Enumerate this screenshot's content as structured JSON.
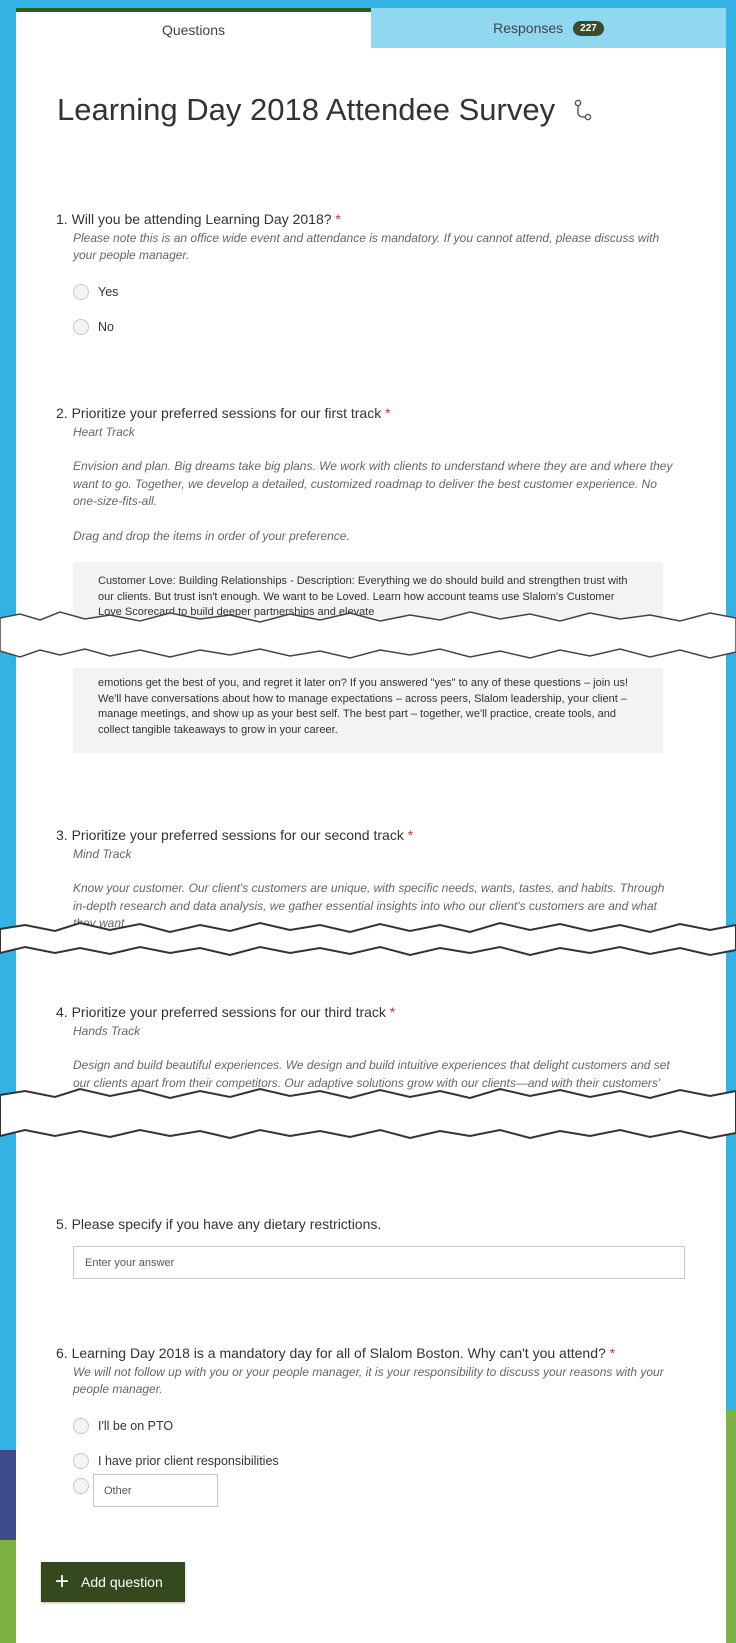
{
  "tabs": {
    "questions_label": "Questions",
    "responses_label": "Responses",
    "responses_count": "227"
  },
  "form_title": "Learning Day 2018 Attendee Survey",
  "required_mark": "*",
  "q1": {
    "title": "1. Will you be attending Learning Day 2018?",
    "subtitle": "Please note this is an office wide event and attendance is mandatory. If you cannot attend, please discuss with your people manager.",
    "options": [
      "Yes",
      "No"
    ]
  },
  "q2": {
    "title": "2. Prioritize your preferred sessions for our first track",
    "track": "Heart Track",
    "desc": "Envision and plan. Big dreams take big plans. We work with clients to understand where they are and where they want to go. Together, we develop a detailed, customized roadmap to deliver the best customer experience. No one-size-fits-all.",
    "instruction": "Drag and drop the items in order of your preference.",
    "item_top": "Customer Love: Building Relationships - Description: Everything we do should build and strengthen trust with our clients. But trust isn't enough.  We want to be Loved. Learn how account teams use Slalom's Customer Love Scorecard to build deeper partnerships and elevate",
    "item_bottom": "emotions get the best of you, and regret it later on? If you answered \"yes\" to any of these questions – join us! We'll have conversations about how to manage expectations – across peers, Slalom leadership, your client – manage meetings, and show up as your best self. The best part – together, we'll practice, create tools, and collect tangible takeaways to grow in your career."
  },
  "q3": {
    "title": "3. Prioritize your preferred sessions for our second track",
    "track": "Mind Track",
    "desc": "Know your customer. Our client's customers are unique, with specific needs, wants, tastes, and habits. Through in-depth research and data analysis, we gather essential insights into who our client's customers are and what they want."
  },
  "q4": {
    "title": "4. Prioritize your preferred sessions for our third track",
    "track": "Hands Track",
    "desc": "Design and build beautiful experiences. We design and build intuitive experiences that delight customers and set our clients apart from their competitors. Our adaptive solutions grow with our clients—and with their customers'"
  },
  "q5": {
    "title": "5. Please specify if you have any dietary restrictions.",
    "placeholder": "Enter your answer"
  },
  "q6": {
    "title": "6. Learning Day 2018 is a mandatory day for all of Slalom Boston. Why can't you attend?",
    "subtitle": "We will not follow up with you or your people manager, it is your responsibility to discuss your reasons with your people manager.",
    "options": [
      "I'll be on PTO",
      "I have prior client responsibilities"
    ],
    "other_placeholder": "Other"
  },
  "add_question_label": "Add question",
  "colors": {
    "background": "#33b2e3",
    "accent": "#35491e",
    "tab_inactive": "#90d8f0",
    "required": "#c0392b"
  }
}
